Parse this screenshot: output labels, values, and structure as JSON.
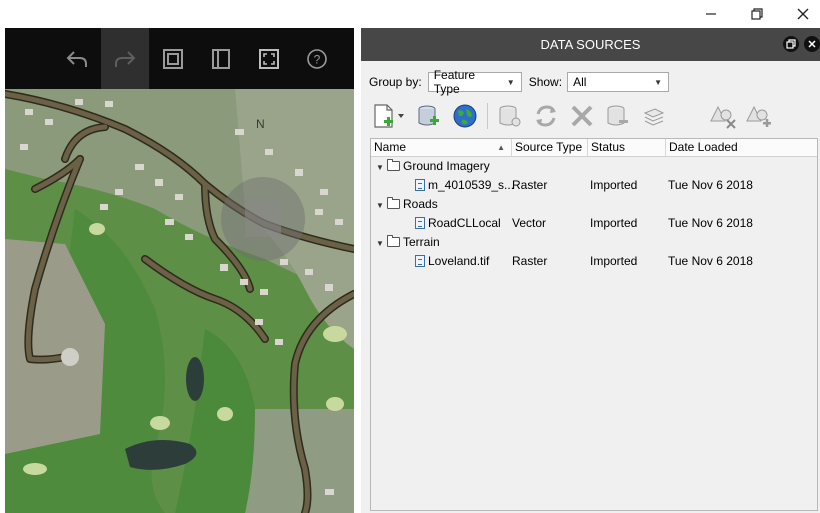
{
  "window": {
    "minimize_icon": "minimize-icon",
    "restore_icon": "restore-icon",
    "close_icon": "close-icon"
  },
  "map_toolbar": {
    "buttons": [
      {
        "name": "undo",
        "icon": "undo-arrow-icon",
        "enabled": true
      },
      {
        "name": "redo",
        "icon": "redo-arrow-icon",
        "enabled": false
      },
      {
        "name": "layers",
        "icon": "layers-icon",
        "enabled": true
      },
      {
        "name": "book",
        "icon": "book-icon",
        "enabled": true
      },
      {
        "name": "fullscreen",
        "icon": "fullscreen-icon",
        "enabled": true
      },
      {
        "name": "help",
        "icon": "help-icon",
        "enabled": true
      }
    ]
  },
  "compass": {
    "north_label": "N"
  },
  "data_sources": {
    "title": "DATA SOURCES",
    "group_by_label": "Group by:",
    "group_by_value": "Feature Type",
    "show_label": "Show:",
    "show_value": "All",
    "columns": {
      "name": "Name",
      "source_type": "Source Type",
      "status": "Status",
      "date_loaded": "Date Loaded"
    },
    "tree": [
      {
        "group": "Ground Imagery",
        "items": [
          {
            "name": "m_4010539_s...",
            "source_type": "Raster",
            "status": "Imported",
            "date_loaded": "Tue Nov 6 2018"
          }
        ]
      },
      {
        "group": "Roads",
        "items": [
          {
            "name": "RoadCLLocal",
            "source_type": "Vector",
            "status": "Imported",
            "date_loaded": "Tue Nov 6 2018"
          }
        ]
      },
      {
        "group": "Terrain",
        "items": [
          {
            "name": "Loveland.tif",
            "source_type": "Raster",
            "status": "Imported",
            "date_loaded": "Tue Nov 6 2018"
          }
        ]
      }
    ]
  },
  "colors": {
    "panel_title_bg": "#474747",
    "toolbar_bg": "#0d0d0d",
    "grass": "#4d8a3a",
    "road": "#5b5237",
    "road_edge": "#2e2a1c",
    "water": "#2d3d3a"
  }
}
